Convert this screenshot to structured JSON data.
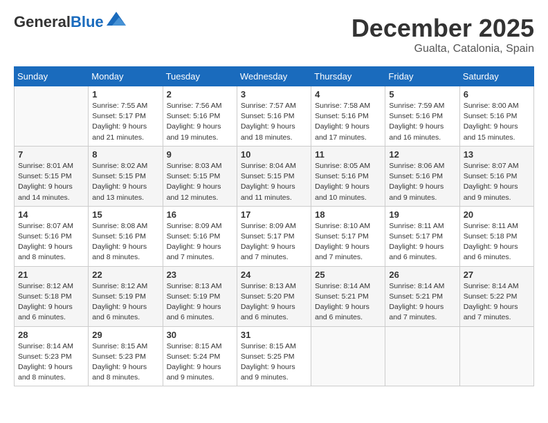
{
  "header": {
    "logo_general": "General",
    "logo_blue": "Blue",
    "month": "December 2025",
    "location": "Gualta, Catalonia, Spain"
  },
  "weekdays": [
    "Sunday",
    "Monday",
    "Tuesday",
    "Wednesday",
    "Thursday",
    "Friday",
    "Saturday"
  ],
  "weeks": [
    [
      {
        "day": "",
        "sunrise": "",
        "sunset": "",
        "daylight": ""
      },
      {
        "day": "1",
        "sunrise": "Sunrise: 7:55 AM",
        "sunset": "Sunset: 5:17 PM",
        "daylight": "Daylight: 9 hours and 21 minutes."
      },
      {
        "day": "2",
        "sunrise": "Sunrise: 7:56 AM",
        "sunset": "Sunset: 5:16 PM",
        "daylight": "Daylight: 9 hours and 19 minutes."
      },
      {
        "day": "3",
        "sunrise": "Sunrise: 7:57 AM",
        "sunset": "Sunset: 5:16 PM",
        "daylight": "Daylight: 9 hours and 18 minutes."
      },
      {
        "day": "4",
        "sunrise": "Sunrise: 7:58 AM",
        "sunset": "Sunset: 5:16 PM",
        "daylight": "Daylight: 9 hours and 17 minutes."
      },
      {
        "day": "5",
        "sunrise": "Sunrise: 7:59 AM",
        "sunset": "Sunset: 5:16 PM",
        "daylight": "Daylight: 9 hours and 16 minutes."
      },
      {
        "day": "6",
        "sunrise": "Sunrise: 8:00 AM",
        "sunset": "Sunset: 5:16 PM",
        "daylight": "Daylight: 9 hours and 15 minutes."
      }
    ],
    [
      {
        "day": "7",
        "sunrise": "Sunrise: 8:01 AM",
        "sunset": "Sunset: 5:15 PM",
        "daylight": "Daylight: 9 hours and 14 minutes."
      },
      {
        "day": "8",
        "sunrise": "Sunrise: 8:02 AM",
        "sunset": "Sunset: 5:15 PM",
        "daylight": "Daylight: 9 hours and 13 minutes."
      },
      {
        "day": "9",
        "sunrise": "Sunrise: 8:03 AM",
        "sunset": "Sunset: 5:15 PM",
        "daylight": "Daylight: 9 hours and 12 minutes."
      },
      {
        "day": "10",
        "sunrise": "Sunrise: 8:04 AM",
        "sunset": "Sunset: 5:15 PM",
        "daylight": "Daylight: 9 hours and 11 minutes."
      },
      {
        "day": "11",
        "sunrise": "Sunrise: 8:05 AM",
        "sunset": "Sunset: 5:16 PM",
        "daylight": "Daylight: 9 hours and 10 minutes."
      },
      {
        "day": "12",
        "sunrise": "Sunrise: 8:06 AM",
        "sunset": "Sunset: 5:16 PM",
        "daylight": "Daylight: 9 hours and 9 minutes."
      },
      {
        "day": "13",
        "sunrise": "Sunrise: 8:07 AM",
        "sunset": "Sunset: 5:16 PM",
        "daylight": "Daylight: 9 hours and 9 minutes."
      }
    ],
    [
      {
        "day": "14",
        "sunrise": "Sunrise: 8:07 AM",
        "sunset": "Sunset: 5:16 PM",
        "daylight": "Daylight: 9 hours and 8 minutes."
      },
      {
        "day": "15",
        "sunrise": "Sunrise: 8:08 AM",
        "sunset": "Sunset: 5:16 PM",
        "daylight": "Daylight: 9 hours and 8 minutes."
      },
      {
        "day": "16",
        "sunrise": "Sunrise: 8:09 AM",
        "sunset": "Sunset: 5:16 PM",
        "daylight": "Daylight: 9 hours and 7 minutes."
      },
      {
        "day": "17",
        "sunrise": "Sunrise: 8:09 AM",
        "sunset": "Sunset: 5:17 PM",
        "daylight": "Daylight: 9 hours and 7 minutes."
      },
      {
        "day": "18",
        "sunrise": "Sunrise: 8:10 AM",
        "sunset": "Sunset: 5:17 PM",
        "daylight": "Daylight: 9 hours and 7 minutes."
      },
      {
        "day": "19",
        "sunrise": "Sunrise: 8:11 AM",
        "sunset": "Sunset: 5:17 PM",
        "daylight": "Daylight: 9 hours and 6 minutes."
      },
      {
        "day": "20",
        "sunrise": "Sunrise: 8:11 AM",
        "sunset": "Sunset: 5:18 PM",
        "daylight": "Daylight: 9 hours and 6 minutes."
      }
    ],
    [
      {
        "day": "21",
        "sunrise": "Sunrise: 8:12 AM",
        "sunset": "Sunset: 5:18 PM",
        "daylight": "Daylight: 9 hours and 6 minutes."
      },
      {
        "day": "22",
        "sunrise": "Sunrise: 8:12 AM",
        "sunset": "Sunset: 5:19 PM",
        "daylight": "Daylight: 9 hours and 6 minutes."
      },
      {
        "day": "23",
        "sunrise": "Sunrise: 8:13 AM",
        "sunset": "Sunset: 5:19 PM",
        "daylight": "Daylight: 9 hours and 6 minutes."
      },
      {
        "day": "24",
        "sunrise": "Sunrise: 8:13 AM",
        "sunset": "Sunset: 5:20 PM",
        "daylight": "Daylight: 9 hours and 6 minutes."
      },
      {
        "day": "25",
        "sunrise": "Sunrise: 8:14 AM",
        "sunset": "Sunset: 5:21 PM",
        "daylight": "Daylight: 9 hours and 6 minutes."
      },
      {
        "day": "26",
        "sunrise": "Sunrise: 8:14 AM",
        "sunset": "Sunset: 5:21 PM",
        "daylight": "Daylight: 9 hours and 7 minutes."
      },
      {
        "day": "27",
        "sunrise": "Sunrise: 8:14 AM",
        "sunset": "Sunset: 5:22 PM",
        "daylight": "Daylight: 9 hours and 7 minutes."
      }
    ],
    [
      {
        "day": "28",
        "sunrise": "Sunrise: 8:14 AM",
        "sunset": "Sunset: 5:23 PM",
        "daylight": "Daylight: 9 hours and 8 minutes."
      },
      {
        "day": "29",
        "sunrise": "Sunrise: 8:15 AM",
        "sunset": "Sunset: 5:23 PM",
        "daylight": "Daylight: 9 hours and 8 minutes."
      },
      {
        "day": "30",
        "sunrise": "Sunrise: 8:15 AM",
        "sunset": "Sunset: 5:24 PM",
        "daylight": "Daylight: 9 hours and 9 minutes."
      },
      {
        "day": "31",
        "sunrise": "Sunrise: 8:15 AM",
        "sunset": "Sunset: 5:25 PM",
        "daylight": "Daylight: 9 hours and 9 minutes."
      },
      {
        "day": "",
        "sunrise": "",
        "sunset": "",
        "daylight": ""
      },
      {
        "day": "",
        "sunrise": "",
        "sunset": "",
        "daylight": ""
      },
      {
        "day": "",
        "sunrise": "",
        "sunset": "",
        "daylight": ""
      }
    ]
  ]
}
